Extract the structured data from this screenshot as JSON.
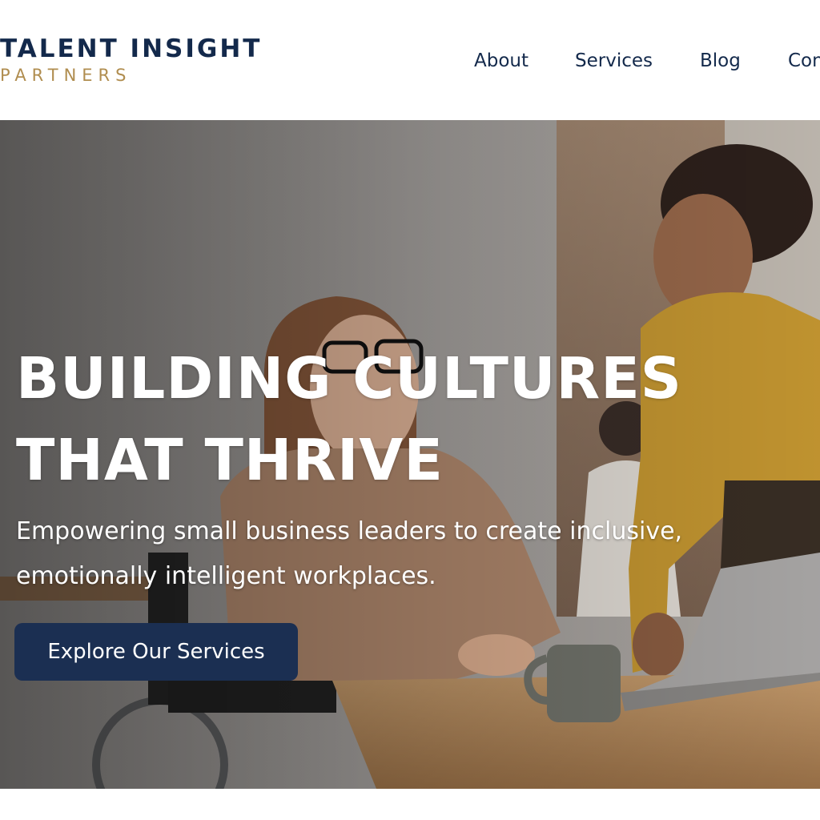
{
  "brand": {
    "name_line1": "TALENT INSIGHT",
    "name_line2": "PARTNERS",
    "primary_color": "#13294b",
    "accent_color": "#b08d4f"
  },
  "nav": {
    "items": [
      {
        "label": "About"
      },
      {
        "label": "Services"
      },
      {
        "label": "Blog"
      },
      {
        "label": "Contact"
      }
    ]
  },
  "hero": {
    "title_line1": "BUILDING CULTURES",
    "title_line2": "THAT THRIVE",
    "subtitle": "Empowering small business leaders to create inclusive, emotionally intelligent workplaces.",
    "cta_label": "Explore Our Services",
    "cta_color": "#1b2f52",
    "image_description": "photo-two-women-office-laptop"
  }
}
